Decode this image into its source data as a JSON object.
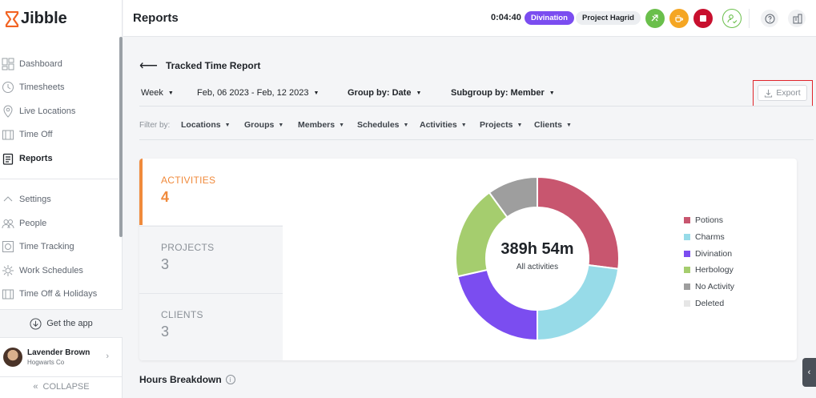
{
  "app": {
    "name": "Jibble"
  },
  "sidebar": {
    "items": [
      {
        "label": "Dashboard",
        "icon": "dashboard-icon",
        "active": false
      },
      {
        "label": "Timesheets",
        "icon": "clock-icon",
        "active": false
      },
      {
        "label": "Live Locations",
        "icon": "location-pin-icon",
        "active": false
      },
      {
        "label": "Time Off",
        "icon": "calendar-icon",
        "active": false
      },
      {
        "label": "Reports",
        "icon": "clipboard-icon",
        "active": true
      },
      {
        "label": "Settings",
        "icon": "chevron-up-icon",
        "active": false
      },
      {
        "label": "People",
        "icon": "people-icon",
        "active": false
      },
      {
        "label": "Time Tracking",
        "icon": "time-tracking-icon",
        "active": false
      },
      {
        "label": "Work Schedules",
        "icon": "gear-icon",
        "active": false
      },
      {
        "label": "Time Off & Holidays",
        "icon": "calendar-icon",
        "active": false
      }
    ],
    "get_app": "Get the app",
    "user": {
      "name": "Lavender Brown",
      "org": "Hogwarts Co"
    },
    "collapse": "COLLAPSE"
  },
  "header": {
    "title": "Reports",
    "timer": "0:04:40",
    "activity": "Divination",
    "project": "Project Hagrid"
  },
  "report": {
    "title": "Tracked Time Report",
    "period": "Week",
    "date_range": "Feb, 06 2023 - Feb, 12 2023",
    "group_by": "Group by: Date",
    "subgroup_by": "Subgroup by: Member",
    "export": "Export"
  },
  "filters": {
    "label": "Filter by:",
    "items": [
      "Locations",
      "Groups",
      "Members",
      "Schedules",
      "Activities",
      "Projects",
      "Clients"
    ]
  },
  "summary_tabs": [
    {
      "label": "ACTIVITIES",
      "value": "4"
    },
    {
      "label": "PROJECTS",
      "value": "3"
    },
    {
      "label": "CLIENTS",
      "value": "3"
    }
  ],
  "donut": {
    "total": "389h 54m",
    "caption": "All activities"
  },
  "chart_data": {
    "type": "pie",
    "categories": [
      "Potions",
      "Charms",
      "Divination",
      "Herbology",
      "No Activity",
      "Deleted"
    ],
    "values": [
      27,
      23,
      21.5,
      18.5,
      10,
      0
    ],
    "colors": [
      "#c8566f",
      "#97dbe8",
      "#7b4df0",
      "#a5cd6e",
      "#9e9e9e",
      "#e6e6e6"
    ],
    "legend": "right"
  },
  "hours_breakdown": {
    "title": "Hours Breakdown"
  }
}
